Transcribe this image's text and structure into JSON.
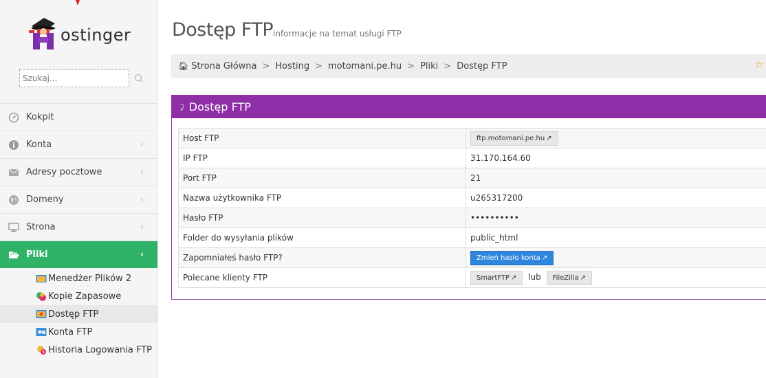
{
  "brand": {
    "logo_text": "ostinger",
    "logo_letter": "H"
  },
  "search": {
    "placeholder": "Szukaj..."
  },
  "sidebar": {
    "items": [
      {
        "label": "Kokpit",
        "icon": "dashboard-icon",
        "chevron": false
      },
      {
        "label": "Konta",
        "icon": "info-icon",
        "chevron": true
      },
      {
        "label": "Adresy pocztowe",
        "icon": "envelope-icon",
        "chevron": true
      },
      {
        "label": "Domeny",
        "icon": "globe-icon",
        "chevron": true
      },
      {
        "label": "Strona",
        "icon": "monitor-icon",
        "chevron": true
      },
      {
        "label": "Pliki",
        "icon": "folder-open-icon",
        "chevron": true,
        "active": true
      }
    ],
    "subitems": [
      {
        "label": "Menedżer Plików 2",
        "icon": "file-manager-icon"
      },
      {
        "label": "Kopie Zapasowe",
        "icon": "backup-icon"
      },
      {
        "label": "Dostęp FTP",
        "icon": "ftp-access-icon",
        "active": true
      },
      {
        "label": "Konta FTP",
        "icon": "ftp-accounts-icon"
      },
      {
        "label": "Historia Logowania FTP",
        "icon": "login-history-icon"
      }
    ]
  },
  "header": {
    "title": "Dostęp FTP",
    "subtitle": "informacje na temat usługi FTP"
  },
  "breadcrumb": {
    "items": [
      "Strona Główna",
      "Hosting",
      "motomani.pe.hu",
      "Pliki",
      "Dostęp FTP"
    ],
    "separator": ">"
  },
  "panel": {
    "title": "Dostęp FTP",
    "rows": [
      {
        "key": "Host FTP",
        "value": "ftp.motomani.pe.hu",
        "kind": "button-light"
      },
      {
        "key": "IP FTP",
        "value": "31.170.164.60",
        "kind": "text"
      },
      {
        "key": "Port FTP",
        "value": "21",
        "kind": "text"
      },
      {
        "key": "Nazwa użytkownika FTP",
        "value": "u265317200",
        "kind": "text"
      },
      {
        "key": "Hasło FTP",
        "value": "••••••••••",
        "kind": "text"
      },
      {
        "key": "Folder do wysyłania plików",
        "value": "public_html",
        "kind": "text"
      },
      {
        "key": "Zapomniałeś hasło FTP?",
        "value": "Zmień hasło konta",
        "kind": "button-blue"
      },
      {
        "key": "Polecane klienty FTP",
        "client1": "SmartFTP",
        "joiner": "lub",
        "client2": "FileZilla",
        "kind": "clients"
      }
    ]
  },
  "colors": {
    "sidebar_active": "#2fb369",
    "panel_accent": "#8e2fa8",
    "button_blue": "#2e86de",
    "star": "#f0a020"
  }
}
